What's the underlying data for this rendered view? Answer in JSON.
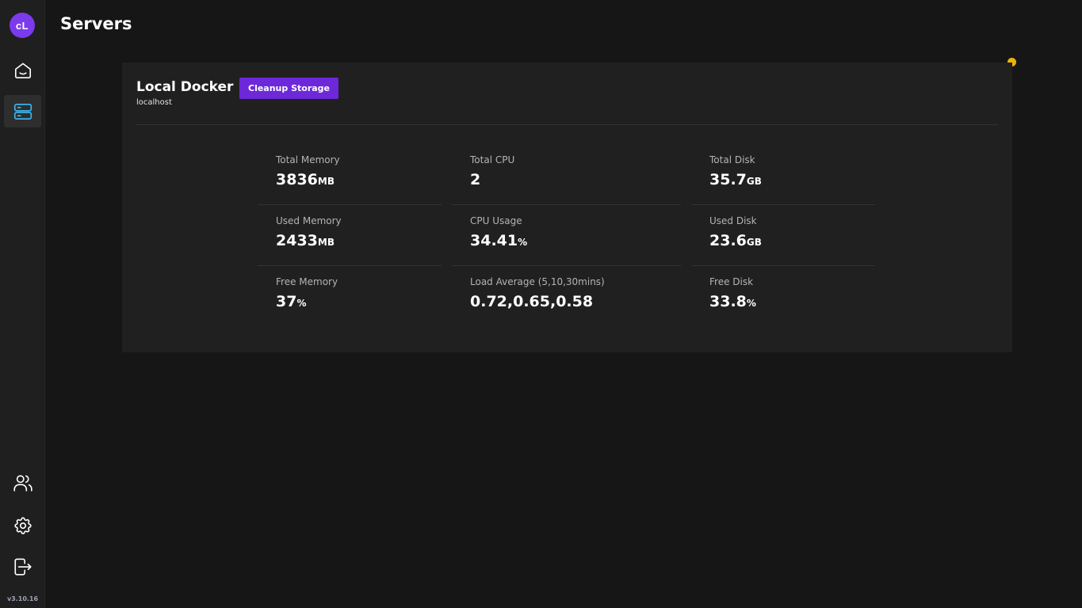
{
  "app": {
    "logo_text": "cL",
    "version": "v3.10.16",
    "brand_color": "#7c3aed",
    "status_color": "#eab308"
  },
  "sidebar": {
    "top_items": [
      {
        "name": "home",
        "icon": "home-icon",
        "active": false
      },
      {
        "name": "servers",
        "icon": "server-icon",
        "active": true
      }
    ],
    "bottom_items": [
      {
        "name": "users",
        "icon": "users-icon"
      },
      {
        "name": "settings",
        "icon": "gear-icon"
      },
      {
        "name": "logout",
        "icon": "logout-icon"
      }
    ]
  },
  "page": {
    "title": "Servers"
  },
  "server": {
    "name": "Local Docker",
    "host": "localhost",
    "cleanup_label": "Cleanup Storage",
    "status": "warning",
    "stats": {
      "memory": [
        {
          "label": "Total Memory",
          "value": "3836",
          "unit": "MB"
        },
        {
          "label": "Used Memory",
          "value": "2433",
          "unit": "MB"
        },
        {
          "label": "Free Memory",
          "value": "37",
          "unit": "%"
        }
      ],
      "cpu": [
        {
          "label": "Total CPU",
          "value": "2",
          "unit": ""
        },
        {
          "label": "CPU Usage",
          "value": "34.41",
          "unit": "%"
        },
        {
          "label": "Load Average (5,10,30mins)",
          "value": "0.72,0.65,0.58",
          "unit": ""
        }
      ],
      "disk": [
        {
          "label": "Total Disk",
          "value": "35.7",
          "unit": "GB"
        },
        {
          "label": "Used Disk",
          "value": "23.6",
          "unit": "GB"
        },
        {
          "label": "Free Disk",
          "value": "33.8",
          "unit": "%"
        }
      ]
    }
  }
}
